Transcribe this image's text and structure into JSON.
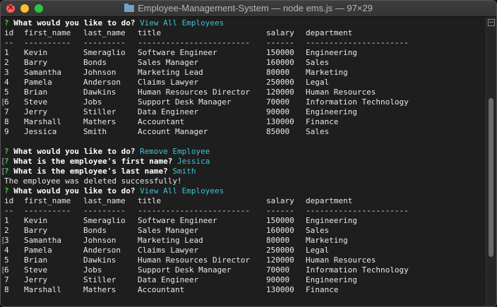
{
  "window": {
    "title": "Employee-Management-System — node ems.js — 97×29"
  },
  "session": [
    {
      "type": "question",
      "mark": "",
      "question": "What would you like to do?",
      "answer": "View All Employees"
    },
    {
      "type": "table",
      "header": [
        "id",
        "first_name",
        "last_name",
        "title",
        "salary",
        "department"
      ],
      "rule": [
        "--",
        "----------",
        "---------",
        "------------------------",
        "------",
        "----------------------"
      ],
      "rows": [
        {
          "mark": "",
          "cells": [
            "1",
            "Kevin",
            "Smeraglio",
            "Software Engineer",
            "150000",
            "Engineering"
          ]
        },
        {
          "mark": "",
          "cells": [
            "2",
            "Barry",
            "Bonds",
            "Sales Manager",
            "160000",
            "Sales"
          ]
        },
        {
          "mark": "",
          "cells": [
            "3",
            "Samantha",
            "Johnson",
            "Marketing Lead",
            "80000",
            "Marketing"
          ]
        },
        {
          "mark": "",
          "cells": [
            "4",
            "Pamela",
            "Anderson",
            "Claims Lawyer",
            "250000",
            "Legal"
          ]
        },
        {
          "mark": "",
          "cells": [
            "5",
            "Brian",
            "Dawkins",
            "Human Resources Director",
            "120000",
            "Human Resources"
          ]
        },
        {
          "mark": "[",
          "rmark": "]",
          "cells": [
            "6",
            "Steve",
            "Jobs",
            "Support Desk Manager",
            "70000",
            "Information Technology"
          ]
        },
        {
          "mark": "",
          "cells": [
            "7",
            "Jerry",
            "Stiller",
            "Data Engineer",
            "90000",
            "Engineering"
          ]
        },
        {
          "mark": "",
          "cells": [
            "8",
            "Marshall",
            "Mathers",
            "Accountant",
            "130000",
            "Finance"
          ]
        },
        {
          "mark": "",
          "cells": [
            "9",
            "Jessica",
            "Smith",
            "Account Manager",
            "85000",
            "Sales"
          ]
        }
      ]
    },
    {
      "type": "blank"
    },
    {
      "type": "question",
      "mark": "",
      "question": "What would you like to do?",
      "answer": "Remove Employee"
    },
    {
      "type": "question",
      "mark": "[",
      "rmark": "]",
      "question": "What is the employee's first name?",
      "answer": "Jessica"
    },
    {
      "type": "question",
      "mark": "[",
      "rmark": "]",
      "question": "What is the employee's last name?",
      "answer": "Smith"
    },
    {
      "type": "text",
      "text": "The employee was deleted successfully!"
    },
    {
      "type": "question",
      "mark": "",
      "question": "What would you like to do?",
      "answer": "View All Employees"
    },
    {
      "type": "table",
      "header": [
        "id",
        "first_name",
        "last_name",
        "title",
        "salary",
        "department"
      ],
      "rule": [
        "--",
        "----------",
        "---------",
        "------------------------",
        "------",
        "----------------------"
      ],
      "rows": [
        {
          "mark": "",
          "cells": [
            "1",
            "Kevin",
            "Smeraglio",
            "Software Engineer",
            "150000",
            "Engineering"
          ]
        },
        {
          "mark": "",
          "cells": [
            "2",
            "Barry",
            "Bonds",
            "Sales Manager",
            "160000",
            "Sales"
          ]
        },
        {
          "mark": "[",
          "rmark": "]",
          "cells": [
            "3",
            "Samantha",
            "Johnson",
            "Marketing Lead",
            "80000",
            "Marketing"
          ]
        },
        {
          "mark": "",
          "cells": [
            "4",
            "Pamela",
            "Anderson",
            "Claims Lawyer",
            "250000",
            "Legal"
          ]
        },
        {
          "mark": "",
          "cells": [
            "5",
            "Brian",
            "Dawkins",
            "Human Resources Director",
            "120000",
            "Human Resources"
          ]
        },
        {
          "mark": "[",
          "rmark": "]",
          "cells": [
            "6",
            "Steve",
            "Jobs",
            "Support Desk Manager",
            "70000",
            "Information Technology"
          ]
        },
        {
          "mark": "",
          "cells": [
            "7",
            "Jerry",
            "Stiller",
            "Data Engineer",
            "90000",
            "Engineering"
          ]
        },
        {
          "mark": "",
          "cells": [
            "8",
            "Marshall",
            "Mathers",
            "Accountant",
            "130000",
            "Finance"
          ]
        }
      ]
    }
  ],
  "prompt_symbol": "?",
  "colors": {
    "prompt_symbol": "#3ad23a",
    "answer": "#3bc3d3",
    "background": "#1e1e1e"
  },
  "icons": {
    "close": "close-icon",
    "minimize": "minimize-icon",
    "maximize": "maximize-icon",
    "folder": "folder-icon"
  }
}
